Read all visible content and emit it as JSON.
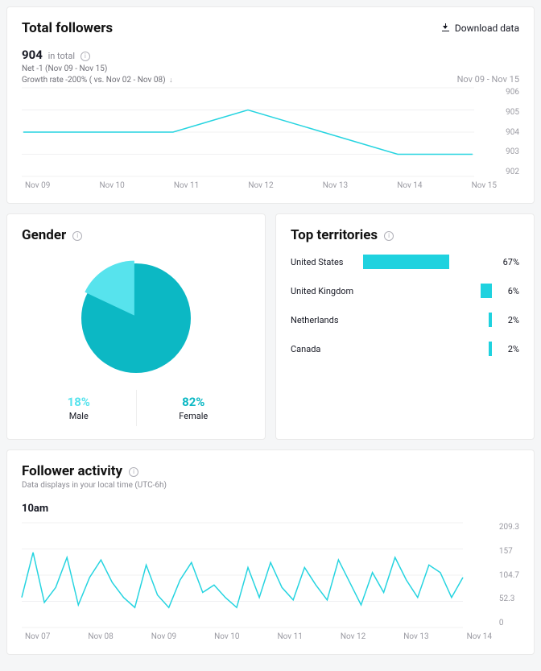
{
  "followers": {
    "title": "Total followers",
    "download_label": "Download data",
    "total_value": "904",
    "total_label": "in total",
    "net_label": "Net -1 (Nov 09 - Nov 15)",
    "growth_label": "Growth rate -200% ( vs. Nov 02 - Nov 08)",
    "date_range": "Nov 09 - Nov 15"
  },
  "gender": {
    "title": "Gender",
    "male_pct": "18%",
    "male_label": "Male",
    "female_pct": "82%",
    "female_label": "Female"
  },
  "territories": {
    "title": "Top territories",
    "rows": [
      {
        "name": "United States",
        "pct": "67%"
      },
      {
        "name": "United Kingdom",
        "pct": "6%"
      },
      {
        "name": "Netherlands",
        "pct": "2%"
      },
      {
        "name": "Canada",
        "pct": "2%"
      }
    ]
  },
  "activity": {
    "title": "Follower activity",
    "subtitle": "Data displays in your local time (UTC-6h)",
    "hour_label": "10am"
  },
  "chart_data": {
    "followers_line": {
      "type": "line",
      "title": "Total followers",
      "xlabel": "",
      "ylabel": "",
      "ylim": [
        902,
        906
      ],
      "categories": [
        "Nov 09",
        "Nov 10",
        "Nov 11",
        "Nov 12",
        "Nov 13",
        "Nov 14",
        "Nov 15"
      ],
      "values": [
        904,
        904,
        904,
        905,
        904,
        903,
        903
      ],
      "y_ticks": [
        "906",
        "905",
        "904",
        "903",
        "902"
      ]
    },
    "gender_pie": {
      "type": "pie",
      "series": [
        {
          "name": "Male",
          "value": 18,
          "color": "#57e3ed"
        },
        {
          "name": "Female",
          "value": 82,
          "color": "#0cb8c4"
        }
      ]
    },
    "territories_bar": {
      "type": "bar",
      "orientation": "horizontal",
      "categories": [
        "United States",
        "United Kingdom",
        "Netherlands",
        "Canada"
      ],
      "values": [
        67,
        6,
        2,
        2
      ],
      "xlim": [
        0,
        100
      ]
    },
    "activity_line": {
      "type": "line",
      "title": "Follower activity",
      "ylim": [
        0,
        209.3
      ],
      "y_ticks": [
        "209.3",
        "157",
        "104.7",
        "52.3",
        "0"
      ],
      "categories": [
        "Nov 07",
        "Nov 08",
        "Nov 09",
        "Nov 10",
        "Nov 11",
        "Nov 12",
        "Nov 13",
        "Nov 14"
      ],
      "values": [
        60,
        150,
        50,
        80,
        140,
        45,
        100,
        135,
        90,
        60,
        40,
        125,
        65,
        40,
        95,
        130,
        70,
        85,
        60,
        40,
        120,
        60,
        130,
        80,
        55,
        120,
        85,
        55,
        135,
        90,
        45,
        110,
        70,
        140,
        95,
        60,
        125,
        110,
        60,
        100
      ]
    }
  }
}
